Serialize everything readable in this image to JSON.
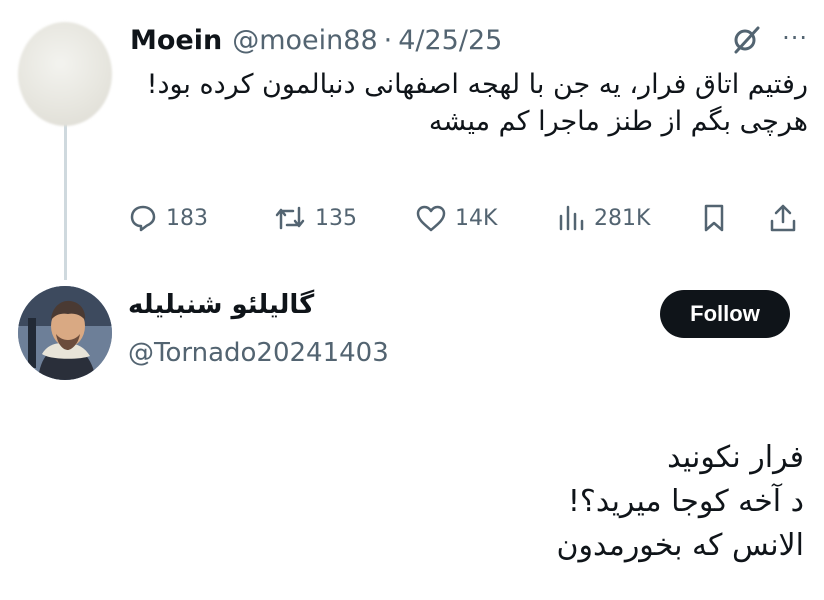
{
  "tweet": {
    "author_name": "Moein",
    "author_handle": "@moein88",
    "separator": "·",
    "date": "4/25/25",
    "text_line1": "رفتیم اتاق فرار، یه جن با لهجه اصفهانی دنبالمون کرده بود!",
    "text_line2": "هرچی بگم از طنز ماجرا کم میشه",
    "more_label": "···",
    "stats": {
      "replies": "183",
      "retweets": "135",
      "likes": "14K",
      "views": "281K"
    }
  },
  "reply": {
    "author_name": "گالیلئو شنبلیله",
    "author_handle": "@Tornado20241403",
    "follow_label": "Follow",
    "lines": [
      "فرار نکونید",
      "د آخه کوجا میرید؟!",
      "الانس که بخورمدون"
    ]
  },
  "icons": [
    "grok-icon",
    "more-icon",
    "reply-icon",
    "retweet-icon",
    "like-icon",
    "views-icon",
    "bookmark-icon",
    "share-icon"
  ],
  "colors": {
    "text": "#0f1419",
    "muted": "#536471",
    "follow_bg": "#0f1419",
    "thread_line": "#cfd9de"
  }
}
